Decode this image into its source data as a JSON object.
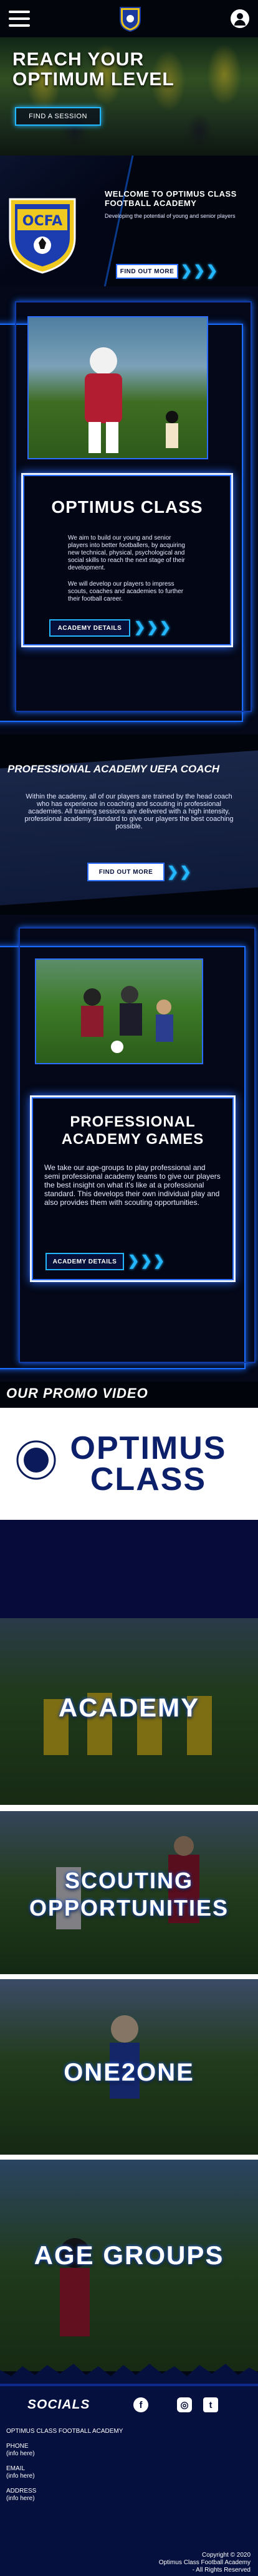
{
  "header": {
    "menu_icon": "hamburger-icon",
    "logo_icon": "club-crest-icon",
    "account_icon": "user-circle-icon"
  },
  "hero": {
    "title_line1": "REACH YOUR",
    "title_line2": "OPTIMUM LEVEL",
    "cta_label": "FIND A SESSION"
  },
  "welcome": {
    "title_line1": "WELCOME TO OPTIMUS CLASS",
    "title_line2": "FOOTBALL ACADEMY",
    "subtitle": "Developing the potential of young and senior players",
    "cta_label": "FIND OUT MORE"
  },
  "optimus": {
    "title": "OPTIMUS CLASS",
    "body1": "We aim to build our young and senior players into better footballers, by acquiring new technical, physical, psychological and social skills to reach the next stage of their development.",
    "body2": "We will develop our players to impress scouts, coaches and academies to further their football career.",
    "cta_label": "ACADEMY DETAILS"
  },
  "uefa": {
    "title": "PROFESSIONAL ACADEMY UEFA COACH",
    "body": "Within the academy, all of our players are trained by the head coach who has experience in coaching and scouting in professional academies. All training sessions are delivered with a high intensity, professional academy standard to give our players the best coaching possible.",
    "cta_label": "FIND OUT MORE"
  },
  "games": {
    "title_line1": "PROFESSIONAL",
    "title_line2": "ACADEMY GAMES",
    "body": "We take our age-groups to play professional and semi professional academy teams to give our players the best insight on what it's like at a professional standard. This develops their own individual play and also provides them with scouting opportunities.",
    "cta_label": "ACADEMY DETAILS"
  },
  "promo": {
    "heading": "OUR PROMO VIDEO",
    "logo_word1": "OPTIMUS",
    "logo_word2": "CLASS"
  },
  "tiles": [
    {
      "label_line1": "ACADEMY",
      "label_line2": ""
    },
    {
      "label_line1": "SCOUTING",
      "label_line2": "OPPORTUNITIES"
    },
    {
      "label_line1": "ONE2ONE",
      "label_line2": ""
    },
    {
      "label_line1": "AGE GROUPS",
      "label_line2": ""
    }
  ],
  "socials": {
    "heading": "SOCIALS",
    "facebook": "f",
    "instagram": "◎",
    "twitter": "t"
  },
  "footer": {
    "org": "OPTIMUS CLASS FOOTBALL ACADEMY",
    "phone_label": "PHONE",
    "phone_value": "(info here)",
    "email_label": "EMAIL",
    "email_value": "(info here)",
    "address_label": "ADDRESS",
    "address_value": "(info here)",
    "copy_line1": "Copyright © 2020",
    "copy_line2": "Optimus Class Football Academy",
    "copy_line3": "- All Rights Reserved"
  },
  "colors": {
    "accent": "#23b7ff",
    "navy": "#05103e",
    "blue": "#2a6cff"
  }
}
